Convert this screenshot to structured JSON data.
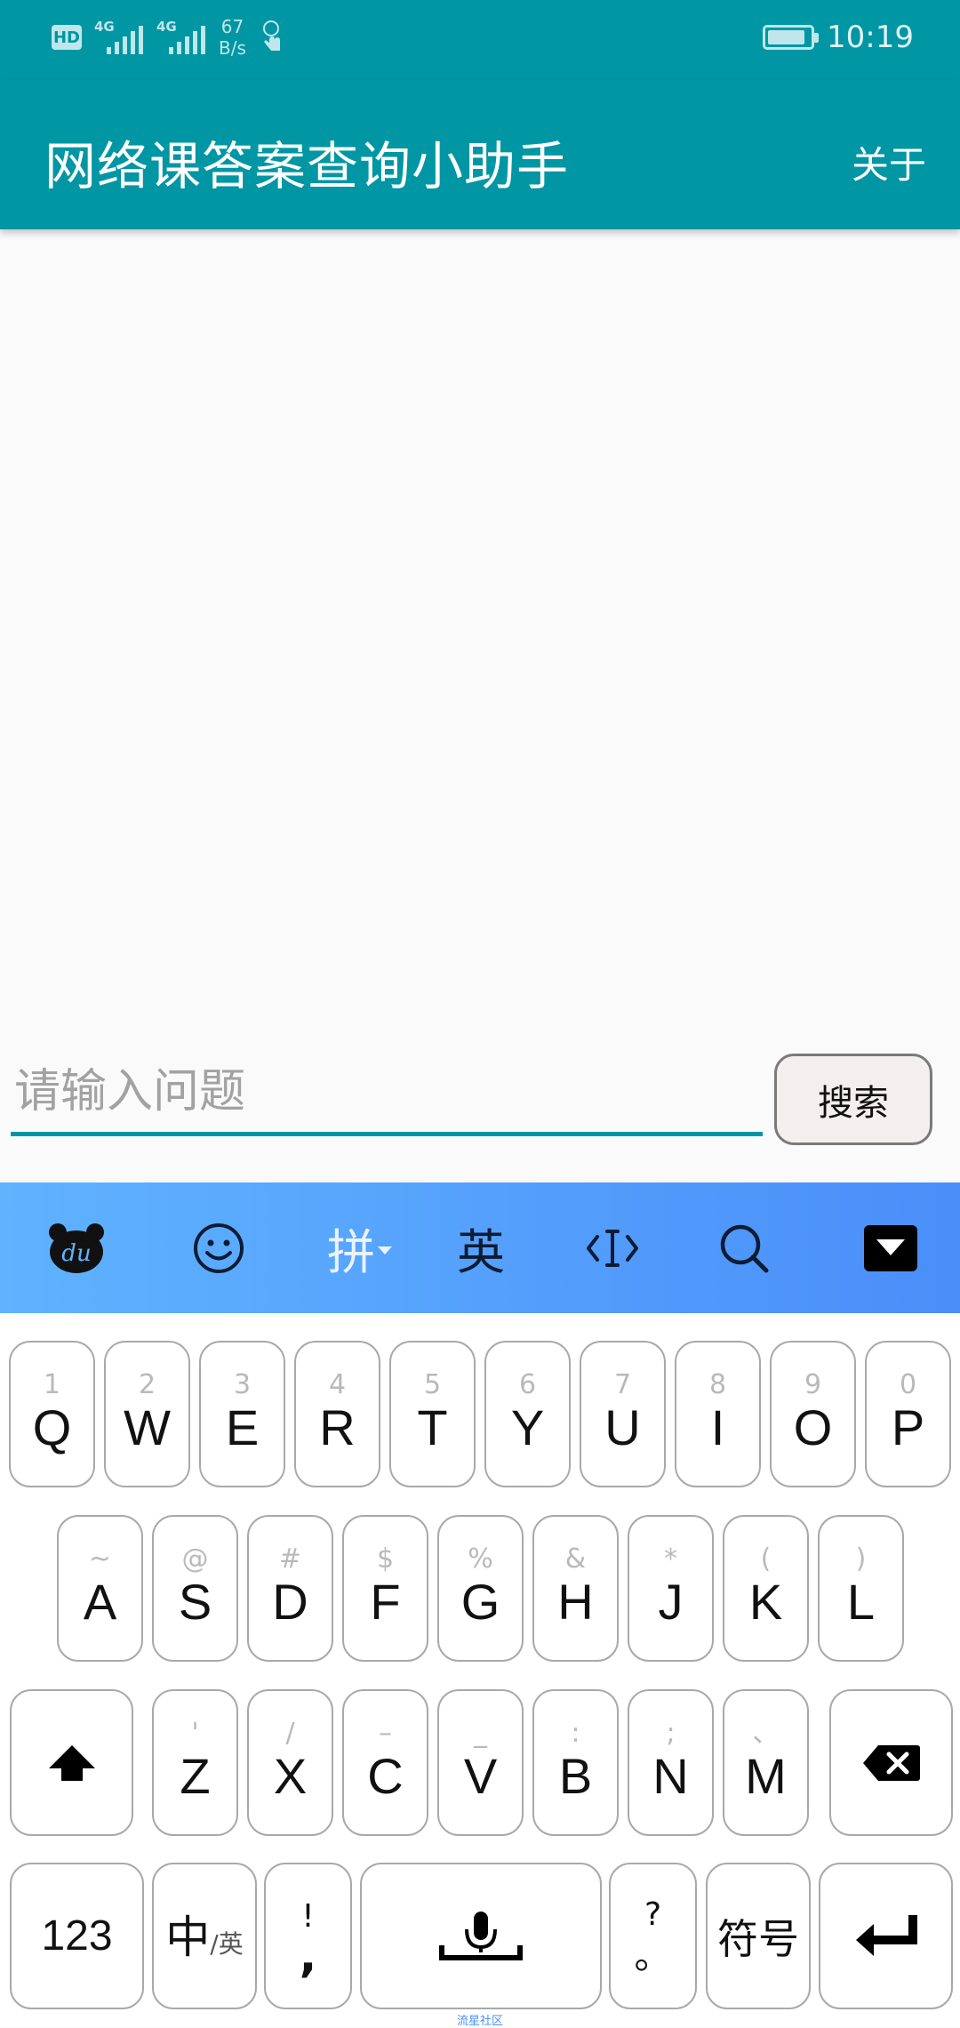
{
  "status_bar": {
    "hd": "HD",
    "network_1": "4G",
    "network_2": "4G",
    "speed_value": "67",
    "speed_unit": "B/s",
    "time": "10:19"
  },
  "app_bar": {
    "title": "网络课答案查询小助手",
    "about_label": "关于"
  },
  "search": {
    "placeholder": "请输入问题",
    "button_label": "搜索"
  },
  "keyboard": {
    "toolbar": {
      "pinyin_label": "拼",
      "english_label": "英"
    },
    "row1": [
      {
        "hint": "1",
        "key": "Q"
      },
      {
        "hint": "2",
        "key": "W"
      },
      {
        "hint": "3",
        "key": "E"
      },
      {
        "hint": "4",
        "key": "R"
      },
      {
        "hint": "5",
        "key": "T"
      },
      {
        "hint": "6",
        "key": "Y"
      },
      {
        "hint": "7",
        "key": "U"
      },
      {
        "hint": "8",
        "key": "I"
      },
      {
        "hint": "9",
        "key": "O"
      },
      {
        "hint": "0",
        "key": "P"
      }
    ],
    "row2": [
      {
        "hint": "~",
        "key": "A"
      },
      {
        "hint": "@",
        "key": "S"
      },
      {
        "hint": "#",
        "key": "D"
      },
      {
        "hint": "$",
        "key": "F"
      },
      {
        "hint": "%",
        "key": "G"
      },
      {
        "hint": "&",
        "key": "H"
      },
      {
        "hint": "*",
        "key": "J"
      },
      {
        "hint": "(",
        "key": "K"
      },
      {
        "hint": ")",
        "key": "L"
      }
    ],
    "row3": [
      {
        "hint": "'",
        "key": "Z"
      },
      {
        "hint": "/",
        "key": "X"
      },
      {
        "hint": "–",
        "key": "C"
      },
      {
        "hint": "_",
        "key": "V"
      },
      {
        "hint": ":",
        "key": "B"
      },
      {
        "hint": ";",
        "key": "N"
      },
      {
        "hint": "、",
        "key": "M"
      }
    ],
    "bottom": {
      "numbers_label": "123",
      "lang_main": "中",
      "lang_sub": "/英",
      "punct_top": "!",
      "punct_bottom": ",",
      "punct2_top": "?",
      "punct2_bottom": "。",
      "symbols_label": "符号"
    }
  },
  "footer_mark": "流星社区",
  "colors": {
    "primary": "#0096a3",
    "keyboard_toolbar_start": "#5fb3ff",
    "keyboard_toolbar_end": "#4a8ef9"
  }
}
